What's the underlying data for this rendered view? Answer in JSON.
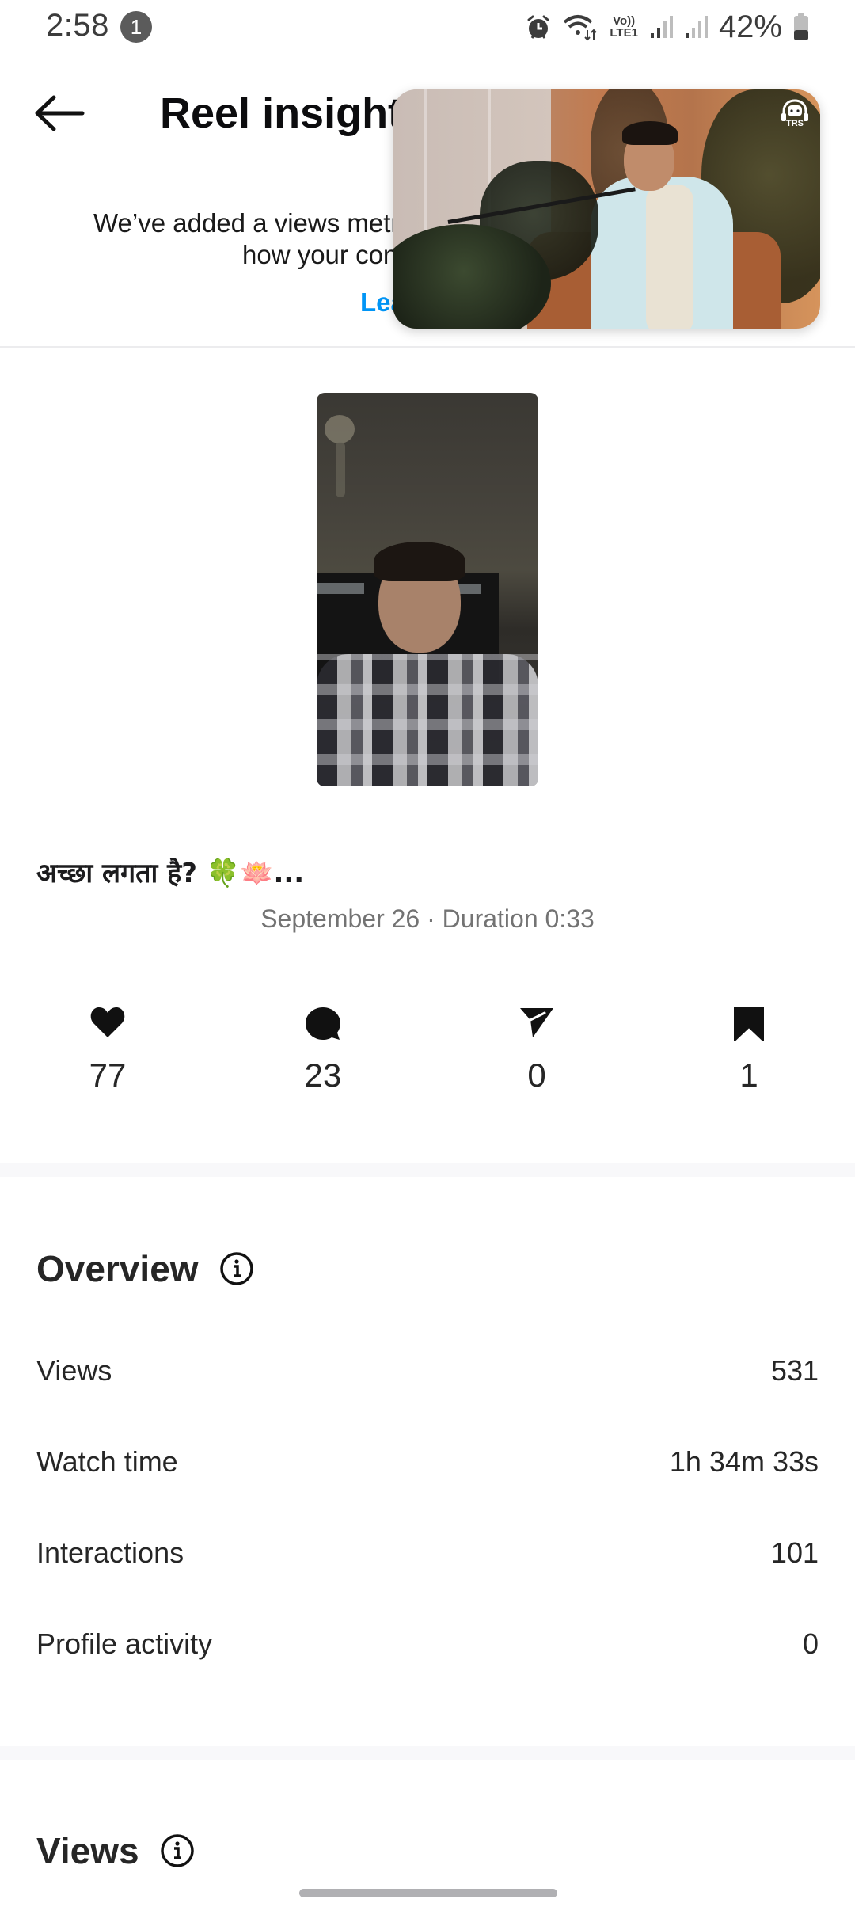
{
  "status_bar": {
    "time": "2:58",
    "notification_count": "1",
    "icons": [
      "alarm-icon",
      "wifi-icon",
      "volte-lte1-icon",
      "signal-sim1-icon",
      "signal-sim2-icon"
    ],
    "volte_label": "Vo))",
    "lte_label": "LTE1",
    "battery_percent": "42%",
    "battery_level": 0.42
  },
  "header": {
    "back_icon": "arrow-left-icon",
    "title": "Reel insights"
  },
  "notice": {
    "line1_visible": "We’ve added a views metr",
    "line2_visible": "how your con",
    "link_visible": "Lea",
    "link_color": "#0095f6"
  },
  "reel": {
    "caption": "अच्छा लगता है? 🍀🪷...",
    "meta": "September 26 · Duration 0:33"
  },
  "engagement": [
    {
      "icon": "heart-icon",
      "name": "likes",
      "value": "77"
    },
    {
      "icon": "comment-icon",
      "name": "comments",
      "value": "23"
    },
    {
      "icon": "share-icon",
      "name": "shares",
      "value": "0"
    },
    {
      "icon": "bookmark-icon",
      "name": "saves",
      "value": "1"
    }
  ],
  "overview": {
    "title": "Overview",
    "info_icon": "info-icon",
    "rows": [
      {
        "label": "Views",
        "value": "531"
      },
      {
        "label": "Watch time",
        "value": "1h 34m 33s"
      },
      {
        "label": "Interactions",
        "value": "101"
      },
      {
        "label": "Profile activity",
        "value": "0"
      }
    ]
  },
  "views_section": {
    "title": "Views",
    "info_icon": "info-icon"
  },
  "pip": {
    "type": "picture-in-picture-video",
    "logo_text": "TRS"
  }
}
